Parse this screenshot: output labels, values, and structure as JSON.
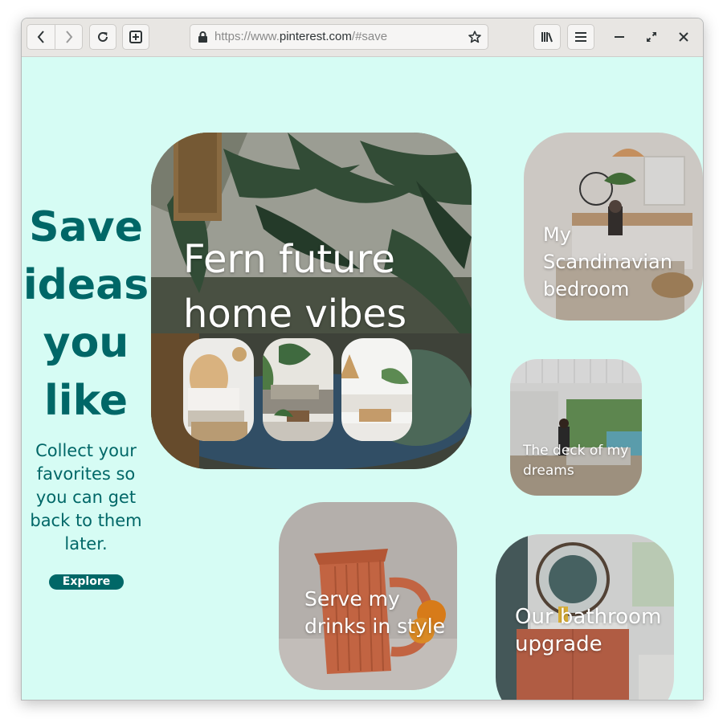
{
  "browser": {
    "url_prefix": "https://www.",
    "url_domain": "pinterest.com",
    "url_suffix": "/#save",
    "icons": {
      "back": "back-arrow-icon",
      "forward": "forward-arrow-icon",
      "reload": "reload-icon",
      "new_tab": "new-tab-icon",
      "lock": "lock-icon",
      "bookmark": "bookmark-star-icon",
      "library": "library-icon",
      "menu": "hamburger-menu-icon",
      "minimize": "minimize-icon",
      "maximize": "maximize-icon",
      "close": "close-icon"
    }
  },
  "hero": {
    "title": "Save ideas you like",
    "subtitle": "Collect your favorites so you can get back to them later.",
    "cta_label": "Explore"
  },
  "cards": {
    "fern": {
      "label": "Fern future home vibes"
    },
    "scandinavian": {
      "label": "My Scandinavian bedroom"
    },
    "deck": {
      "label": "The deck of my dreams"
    },
    "drinks": {
      "label": "Serve my drinks in style"
    },
    "bathroom": {
      "label": "Our bathroom upgrade"
    }
  },
  "colors": {
    "page_background": "#d6fcf4",
    "accent_teal": "#006767",
    "button_text": "#ffffff",
    "card_text": "#ffffff",
    "toolbar": "#e8e6e3"
  }
}
